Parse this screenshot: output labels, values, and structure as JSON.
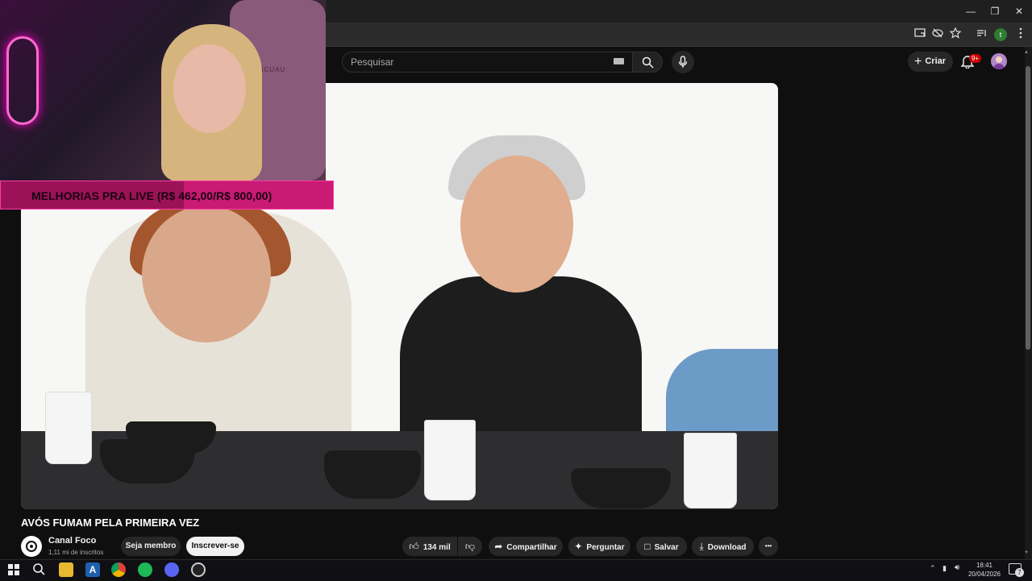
{
  "window": {
    "minimize_label": "—",
    "restore_label": "❐",
    "close_label": "✕"
  },
  "browser": {
    "profile_letter": "t",
    "icons": [
      "cast-icon",
      "eye-off-icon",
      "star-icon",
      "tab-search-icon",
      "profile-icon",
      "more-icon"
    ]
  },
  "header": {
    "search_placeholder": "Pesquisar",
    "create_label": "Criar",
    "notification_count": "9+"
  },
  "stream_overlay": {
    "chair_text": "PICUAU",
    "goal_text": "MELHORIAS PRA LIVE (R$ 462,00/R$ 800,00)",
    "goal_current": 462.0,
    "goal_target": 800.0,
    "goal_fill_fraction": 0.55
  },
  "video": {
    "title": "AVÓS FUMAM PELA PRIMEIRA VEZ"
  },
  "channel": {
    "name": "Canal Foco",
    "subscribers": "1,11 mi de inscritos",
    "member_label": "Seja membro",
    "subscribe_label": "Inscrever-se"
  },
  "actions": {
    "likes": "134 mil",
    "share_label": "Compartilhar",
    "ask_label": "Perguntar",
    "save_label": "Salvar",
    "download_label": "Download",
    "more_label": "•••"
  },
  "taskbar": {
    "time": "18:41",
    "date": "20/04/2026",
    "notification_count": "7",
    "apps": [
      "windows-start",
      "search",
      "file-explorer",
      "app-a",
      "chrome",
      "spotify",
      "discord",
      "obs"
    ]
  },
  "colors": {
    "background": "#0f0f0f",
    "goal_bar": "#c91a74",
    "goal_fill": "#9c1258",
    "notif_badge": "#cc0000"
  }
}
